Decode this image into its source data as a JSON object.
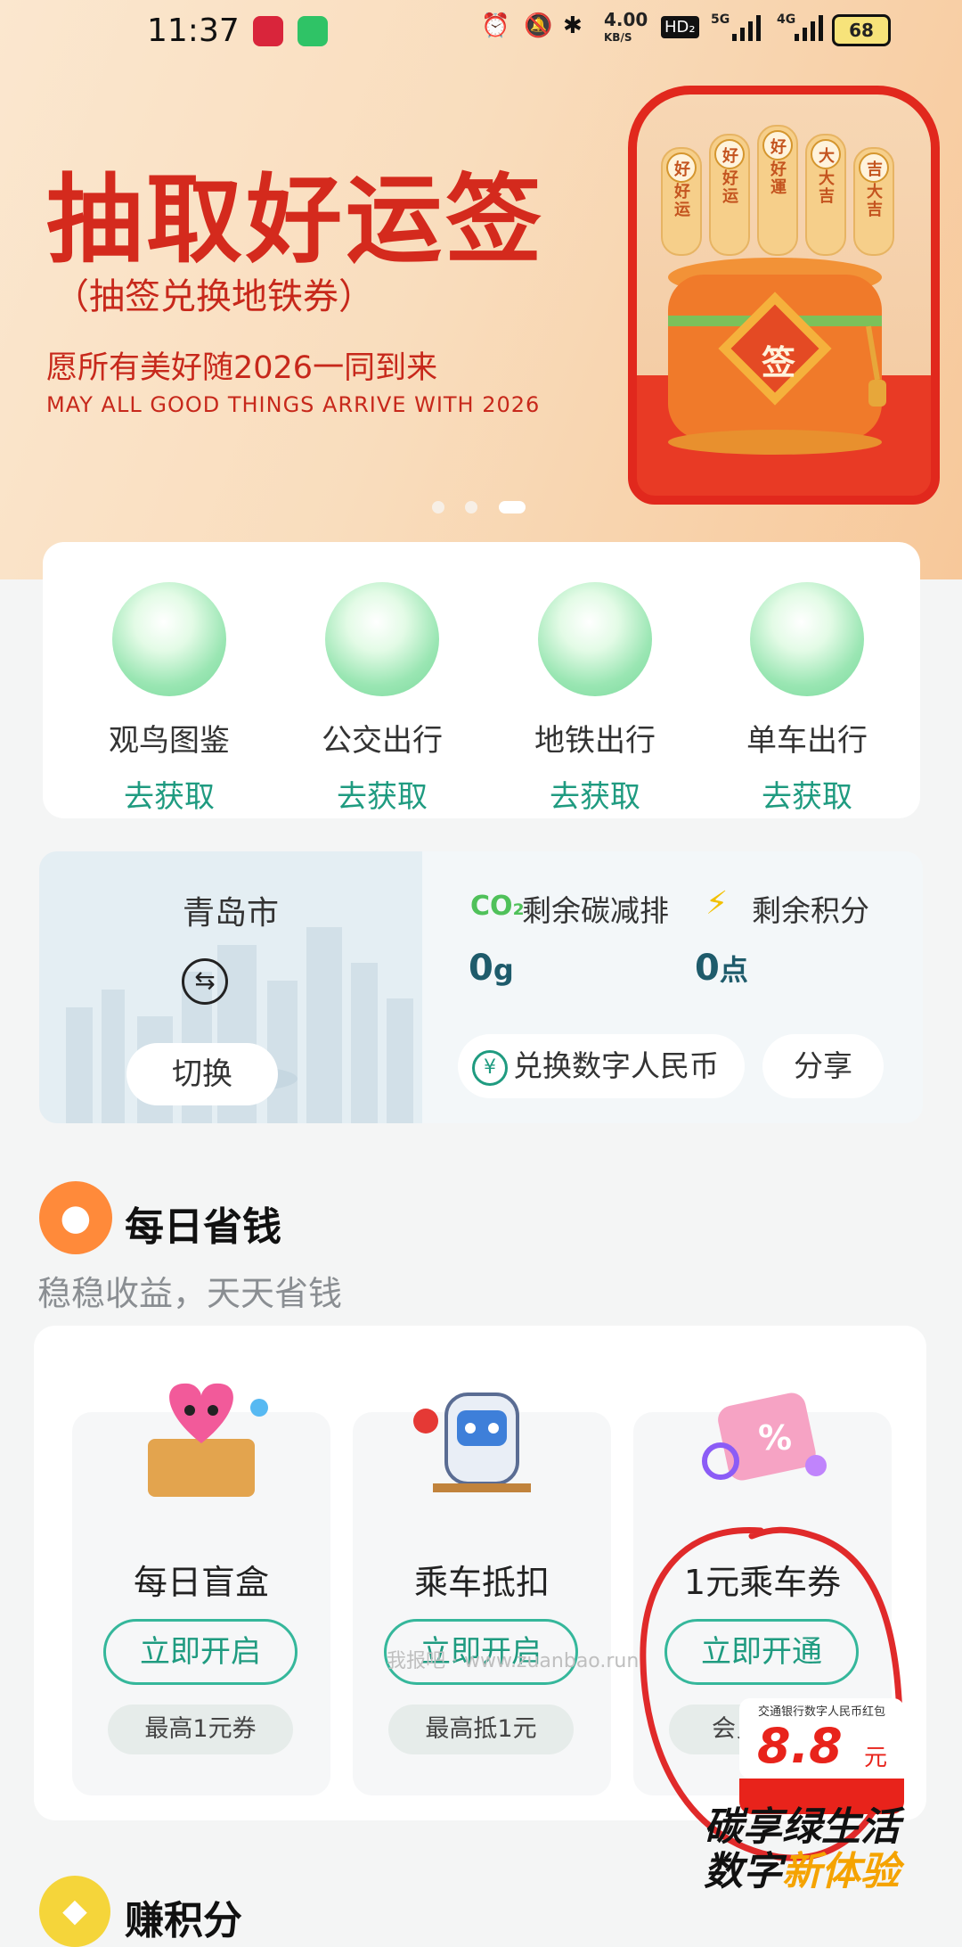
{
  "status_bar": {
    "time": "11:37",
    "speed": "4.00",
    "speed_unit": "KB/S",
    "hd": "HD₂",
    "net1": "5G",
    "net2": "4G",
    "battery": "68"
  },
  "banner": {
    "title": "抽取好运签",
    "subtitle": "（抽签兑换地铁券）",
    "slogan_zh": "愿所有美好随2026一同到来",
    "slogan_en": "MAY ALL GOOD THINGS ARRIVE WITH 2026",
    "stick_texts": [
      "好运",
      "好运",
      "好運",
      "大吉",
      "大吉"
    ],
    "stick_tops": [
      "好",
      "好",
      "好",
      "大",
      "吉"
    ],
    "pot_char": "签",
    "page_count": 3,
    "active_page": 3
  },
  "categories": [
    {
      "name": "观鸟图鉴",
      "action": "去获取"
    },
    {
      "name": "公交出行",
      "action": "去获取"
    },
    {
      "name": "地铁出行",
      "action": "去获取"
    },
    {
      "name": "单车出行",
      "action": "去获取"
    }
  ],
  "city": {
    "name": "青岛市",
    "switch_label": "切换"
  },
  "carbon": {
    "co2_label": "CO₂",
    "remaining_carbon_label": "剩余碳减排",
    "remaining_points_label": "剩余积分",
    "carbon_value": "0",
    "carbon_unit": "g",
    "points_value": "0",
    "points_unit": "点",
    "exchange_label": "兑换数字人民币",
    "share_label": "分享"
  },
  "daily_save": {
    "title": "每日省钱",
    "subtitle": "稳稳收益，天天省钱",
    "items": [
      {
        "name": "每日盲盒",
        "button": "立即开启",
        "tag": "最高1元券"
      },
      {
        "name": "乘车抵扣",
        "button": "立即开启",
        "tag": "最高抵1元"
      },
      {
        "name": "1元乘车券",
        "button": "立即开通",
        "tag": "会员"
      }
    ]
  },
  "watermark": "我报吧 · www.zuanbao.run",
  "promo": {
    "small_text": "交通银行数字人民币红包",
    "amount": "8.8",
    "unit": "元",
    "line1": "碳享绿生活",
    "line2a": "数字",
    "line2b": "新体验"
  },
  "earn": {
    "title": "赚积分"
  },
  "colors": {
    "accent_green": "#1f9b80",
    "banner_red": "#d42a1d",
    "annotation_red": "#e02a2a"
  }
}
